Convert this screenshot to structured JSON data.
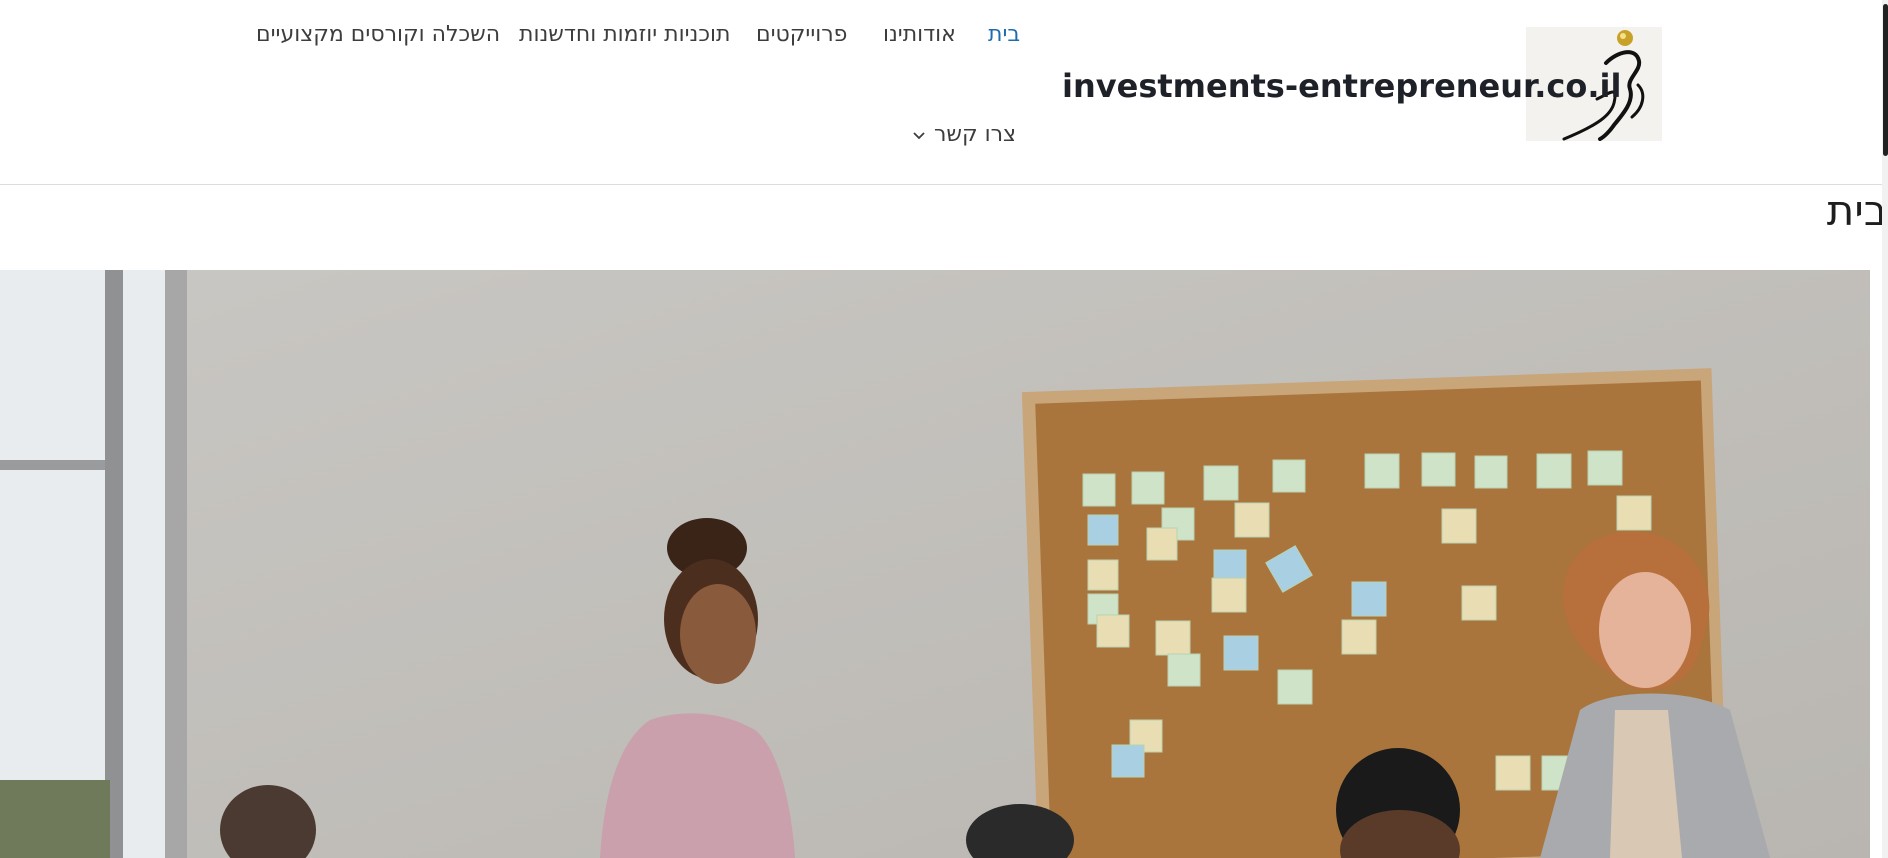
{
  "header": {
    "site_title": "investments-entrepreneur.co.il",
    "logo_icon": "runner-figure-logo",
    "nav": [
      {
        "label": "בית",
        "active": true
      },
      {
        "label": "אודותינו",
        "active": false
      },
      {
        "label": "פרוייקטים",
        "active": false
      },
      {
        "label": "תוכניות יוזמות וחדשנות",
        "active": false
      },
      {
        "label": "השכלה וקורסים מקצועיים",
        "active": false
      }
    ],
    "contact": {
      "label": "צרו קשר",
      "icon": "chevron-down-icon"
    }
  },
  "page": {
    "title": "בית"
  },
  "colors": {
    "active_nav": "#1f6bb0",
    "text": "#3d3d3d",
    "corkboard": "#a9753d"
  }
}
